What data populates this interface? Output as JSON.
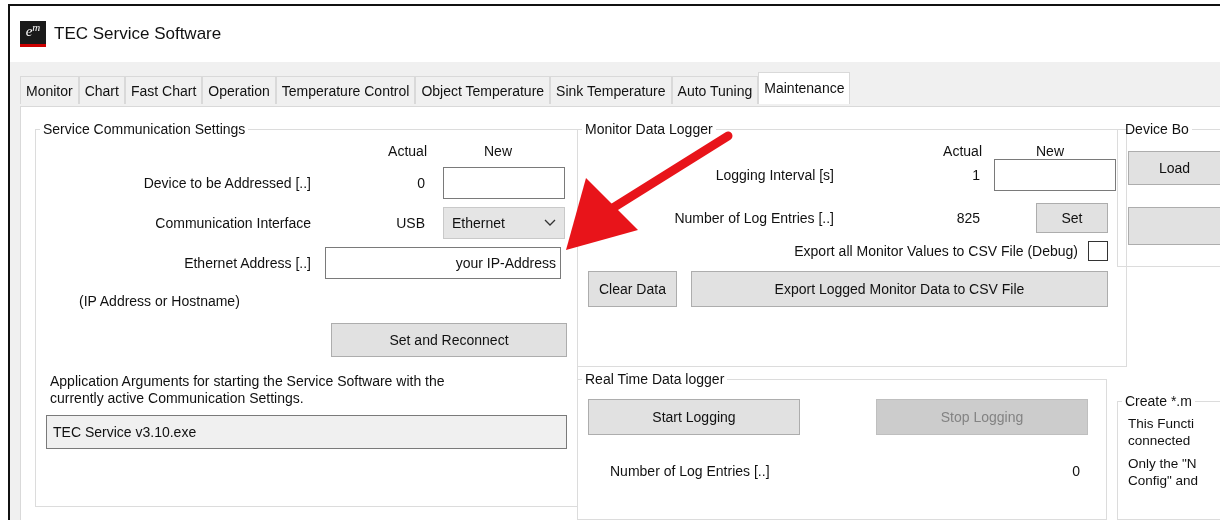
{
  "window": {
    "logo": "e$^{m}$",
    "title": "TEC Service Software"
  },
  "tabs": [
    {
      "label": "Monitor",
      "selected": false
    },
    {
      "label": "Chart",
      "selected": false
    },
    {
      "label": "Fast Chart",
      "selected": false
    },
    {
      "label": "Operation",
      "selected": false
    },
    {
      "label": "Temperature Control",
      "selected": false
    },
    {
      "label": "Object Temperature",
      "selected": false
    },
    {
      "label": "Sink Temperature",
      "selected": false
    },
    {
      "label": "Auto Tuning",
      "selected": false
    },
    {
      "label": "Maintenance",
      "selected": true
    }
  ],
  "communication": {
    "title": "Service Communication Settings",
    "header_actual": "Actual",
    "header_new": "New",
    "rows": [
      {
        "kind": "field",
        "label": "Device to be Addressed [..]",
        "actual": "0"
      },
      {
        "kind": "dropdown",
        "label": "Communication Interface",
        "actual": "USB",
        "value": "Ethernet"
      },
      {
        "kind": "wide-field",
        "label": "Ethernet Address [..]",
        "value": "your IP-Address"
      }
    ],
    "hint": "(IP Address or Hostname)",
    "button": "Set and Reconnect",
    "description": "Application Arguments for starting the Service Software with the currently active Communication Settings.",
    "arguments": "TEC Service v3.10.exe"
  },
  "monitor_logger": {
    "title": "Monitor Data Logger",
    "header_actual": "Actual",
    "header_new": "New",
    "interval": {
      "label": "Logging Interval [s]",
      "actual": "1"
    },
    "entries": {
      "label": "Number of Log Entries [..]",
      "actual": "825"
    },
    "set_button": "Set",
    "export_checkbox": {
      "label": "Export all Monitor Values to CSV File (Debug)",
      "checked": false
    },
    "buttons": [
      "Clear Data",
      "Export Logged Monitor Data to CSV File"
    ]
  },
  "realtime_logger": {
    "title": "Real Time Data logger",
    "buttons": [
      {
        "label": "Start Logging",
        "disabled": false
      },
      {
        "label": "Stop Logging",
        "disabled": true
      }
    ],
    "entries": {
      "label": "Number of Log Entries [..]",
      "value": "0"
    }
  },
  "device_group": {
    "title": "Device Bo",
    "button": "Load"
  },
  "create_group": {
    "title": "Create *.m",
    "lines": [
      "This Functi",
      "connected",
      "Only the \"N",
      "Config\" and"
    ]
  }
}
